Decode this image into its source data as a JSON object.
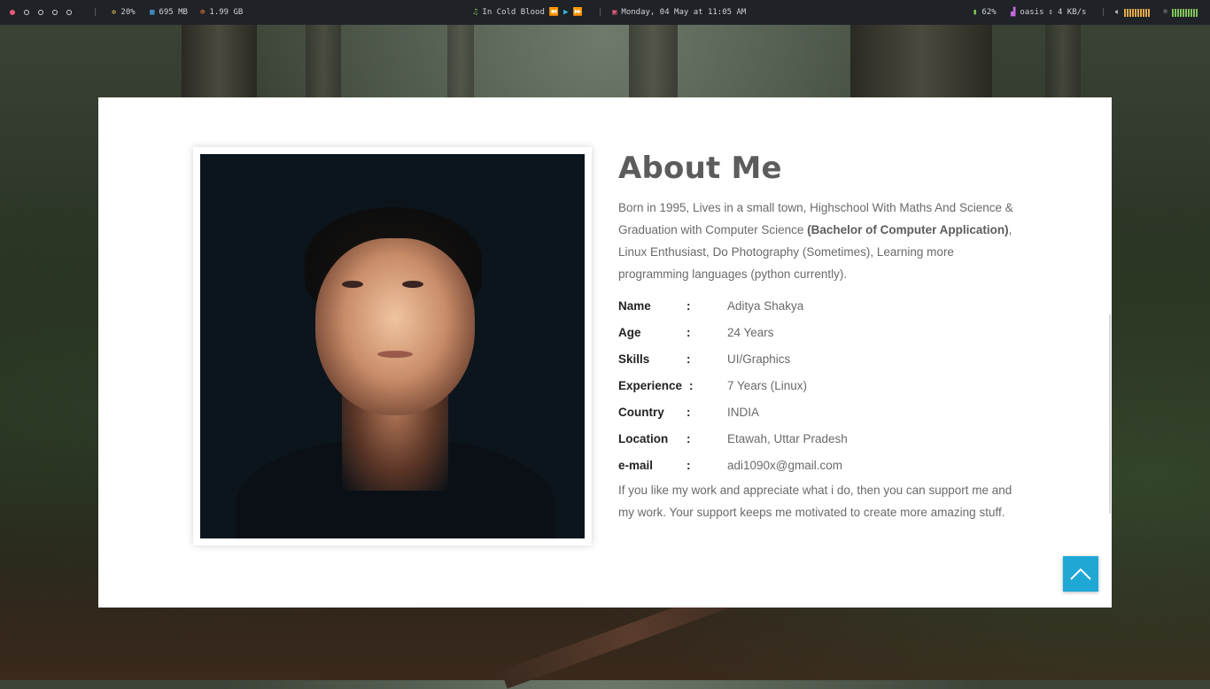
{
  "topbar": {
    "workspaces": [
      {
        "active": true
      },
      {
        "active": false
      },
      {
        "active": false
      },
      {
        "active": false
      },
      {
        "active": false
      }
    ],
    "cpu": "20%",
    "memory": "695 MB",
    "disk": "1.99 GB",
    "song": "In Cold Blood",
    "datetime": "Monday, 04 May at 11:05 AM",
    "battery": "62%",
    "network": "oasis",
    "speed": "4 KB/s",
    "colors": {
      "accent": "#e65a7a",
      "bar_bg": "#1f2226"
    }
  },
  "about": {
    "title": "About Me",
    "bio_part1": "Born in 1995, Lives in a small town, Highschool With Maths And Science & Graduation with Computer Science ",
    "bio_bold": "(Bachelor of Computer Application)",
    "bio_part2": ", Linux Enthusiast, Do Photography (Sometimes), Learning more programming languages (python currently).",
    "colon": ":",
    "details": [
      {
        "label": "Name",
        "value": "Aditya Shakya"
      },
      {
        "label": "Age",
        "value": "24 Years"
      },
      {
        "label": "Skills",
        "value": "UI/Graphics"
      },
      {
        "label": "Experience",
        "value": "7 Years (Linux)"
      },
      {
        "label": "Country",
        "value": "INDIA"
      },
      {
        "label": "Location",
        "value": "Etawah, Uttar Pradesh"
      },
      {
        "label": "e-mail",
        "value": "adi1090x@gmail.com"
      }
    ],
    "support": "If you like my work and appreciate what i do, then you can support me and my work. Your support keeps me motivated to create more amazing stuff."
  },
  "scroll_top": {
    "icon": "chevron-up-icon",
    "color": "#1fa7d6"
  }
}
